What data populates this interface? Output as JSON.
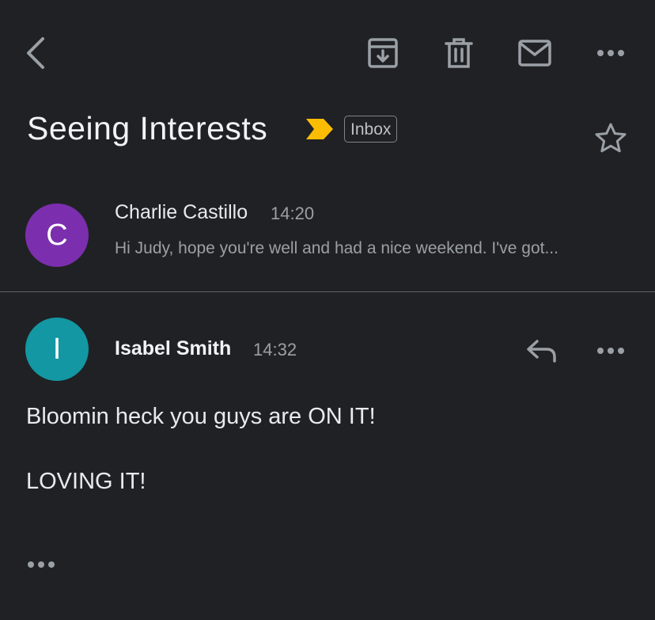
{
  "toolbar": {
    "back_icon": "chevron-left-icon",
    "archive_icon": "archive-icon",
    "delete_icon": "trash-icon",
    "mark_unread_icon": "mail-icon",
    "more_icon": "more-horizontal-icon"
  },
  "thread": {
    "subject": "Seeing Interests",
    "importance_icon": "important-marker-icon",
    "importance_color": "#fbbc04",
    "label": "Inbox",
    "star_icon": "star-outline-icon"
  },
  "messages": [
    {
      "avatar_letter": "C",
      "avatar_color": "#7b2fae",
      "sender": "Charlie Castillo",
      "time": "14:20",
      "snippet": "Hi Judy, hope you're well and had a nice weekend. I've got..."
    },
    {
      "avatar_letter": "I",
      "avatar_color": "#1297a3",
      "sender": "Isabel Smith",
      "time": "14:32",
      "reply_icon": "reply-icon",
      "more_icon": "more-horizontal-icon",
      "body": [
        "Bloomin heck you guys are ON IT!",
        "LOVING IT!"
      ]
    }
  ],
  "expand_icon": "show-trimmed-content-icon"
}
